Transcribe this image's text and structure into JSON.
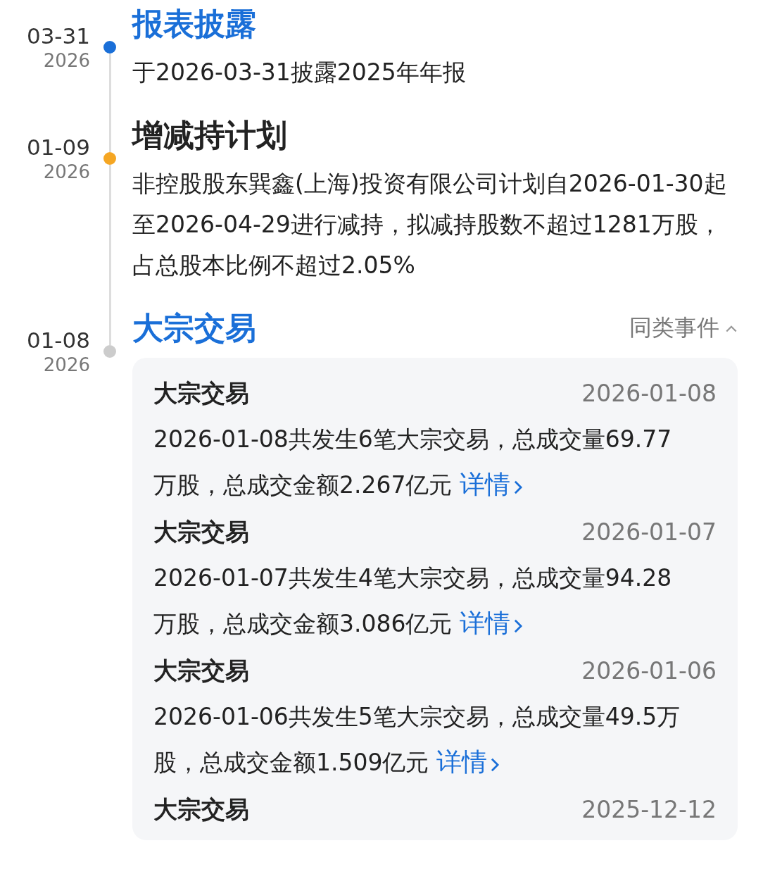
{
  "events": [
    {
      "date": "03-31",
      "year": "2026",
      "color": "#1a6fd8",
      "title": "报表披露",
      "linked": true,
      "body": "于2026-03-31披露2025年年报"
    },
    {
      "date": "01-09",
      "year": "2026",
      "color": "#f5a623",
      "title": "增减持计划",
      "linked": false,
      "body": "非控股股东巽鑫(上海)投资有限公司计划自2026-01-30起至2026-04-29进行减持，拟减持股数不超过1281万股，占总股本比例不超过2.05%"
    },
    {
      "date": "01-08",
      "year": "2026",
      "color": "#cccccc",
      "title": "大宗交易",
      "linked": true,
      "related": {
        "label": "同类事件",
        "expanded": true,
        "items": [
          {
            "title": "大宗交易",
            "date": "2026-01-08",
            "body": "2026-01-08共发生6笔大宗交易，总成交量69.77万股，总成交金额2.267亿元",
            "link": "详情"
          },
          {
            "title": "大宗交易",
            "date": "2026-01-07",
            "body": "2026-01-07共发生4笔大宗交易，总成交量94.28万股，总成交金额3.086亿元",
            "link": "详情"
          },
          {
            "title": "大宗交易",
            "date": "2026-01-06",
            "body": "2026-01-06共发生5笔大宗交易，总成交量49.5万股，总成交金额1.509亿元",
            "link": "详情"
          },
          {
            "title": "大宗交易",
            "date": "2025-12-12"
          }
        ]
      }
    }
  ]
}
